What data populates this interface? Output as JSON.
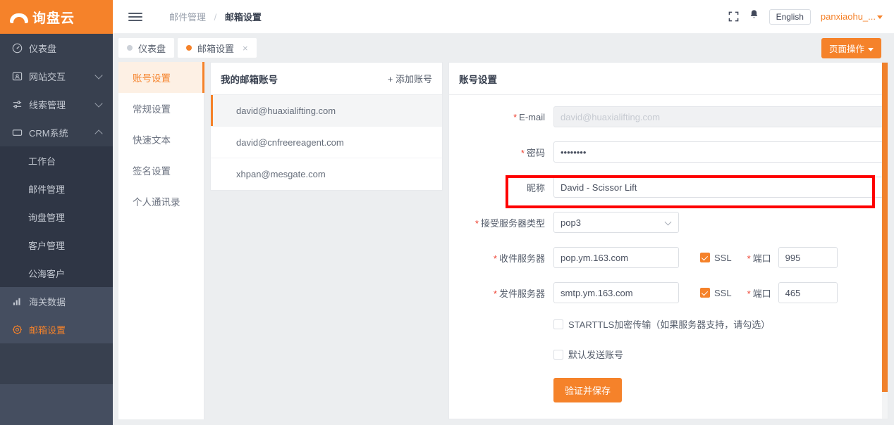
{
  "brand": {
    "name": "询盘云",
    "logo_icon": "cloud-logo-icon",
    "color": "#f5822a"
  },
  "sidebar": {
    "items": [
      {
        "label": "仪表盘",
        "icon": "dashboard-icon",
        "level": "top",
        "state": "normal",
        "chevron": ""
      },
      {
        "label": "网站交互",
        "icon": "monitor-person-icon",
        "level": "top",
        "state": "normal",
        "chevron": "down"
      },
      {
        "label": "线索管理",
        "icon": "sliders-icon",
        "level": "top",
        "state": "normal",
        "chevron": "down"
      },
      {
        "label": "CRM系统",
        "icon": "display-icon",
        "level": "top",
        "state": "normal",
        "chevron": "up"
      },
      {
        "label": "工作台",
        "icon": "",
        "level": "sub",
        "state": "normal",
        "chevron": ""
      },
      {
        "label": "邮件管理",
        "icon": "",
        "level": "sub",
        "state": "normal",
        "chevron": ""
      },
      {
        "label": "询盘管理",
        "icon": "",
        "level": "sub",
        "state": "normal",
        "chevron": ""
      },
      {
        "label": "客户管理",
        "icon": "",
        "level": "sub",
        "state": "normal",
        "chevron": ""
      },
      {
        "label": "公海客户",
        "icon": "",
        "level": "sub",
        "state": "normal",
        "chevron": ""
      },
      {
        "label": "海关数据",
        "icon": "bar-chart-icon",
        "level": "top",
        "state": "hovered",
        "chevron": ""
      },
      {
        "label": "邮箱设置",
        "icon": "gear-icon",
        "level": "top",
        "state": "active",
        "chevron": ""
      }
    ]
  },
  "topbar": {
    "menu_icon": "hamburger-icon",
    "breadcrumb": {
      "parent": "邮件管理",
      "separator": "/",
      "current": "邮箱设置"
    },
    "fullscreen_icon": "expand-icon",
    "bell_icon": "bell-icon",
    "language": "English",
    "user": "panxiaohu_...",
    "user_caret": "caret-down-icon"
  },
  "tabs": {
    "items": [
      {
        "label": "仪表盘",
        "active": false,
        "closable": false
      },
      {
        "label": "邮箱设置",
        "active": true,
        "closable": true
      }
    ],
    "close_glyph": "×",
    "page_action": "页面操作"
  },
  "settings_menu": {
    "items": [
      {
        "label": "账号设置",
        "active": true
      },
      {
        "label": "常规设置",
        "active": false
      },
      {
        "label": "快速文本",
        "active": false
      },
      {
        "label": "签名设置",
        "active": false
      },
      {
        "label": "个人通讯录",
        "active": false
      }
    ]
  },
  "accounts": {
    "title": "我的邮箱账号",
    "add_label": "+ 添加账号",
    "items": [
      {
        "email": "david@huaxialifting.com",
        "active": true
      },
      {
        "email": "david@cnfreereagent.com",
        "active": false
      },
      {
        "email": "xhpan@mesgate.com",
        "active": false
      }
    ]
  },
  "form": {
    "title": "账号设置",
    "email": {
      "label": "E-mail",
      "required": true,
      "value": "",
      "placeholder": "david@huaxialifting.com",
      "disabled": true
    },
    "password": {
      "label": "密码",
      "required": true,
      "value": "••••••••"
    },
    "nickname": {
      "label": "昵称",
      "required": false,
      "value": "David - Scissor Lift",
      "highlighted": true
    },
    "server_type": {
      "label": "接受服务器类型",
      "required": true,
      "value": "pop3",
      "chevron_icon": "chevron-down-icon"
    },
    "incoming": {
      "label": "收件服务器",
      "required": true,
      "value": "pop.ym.163.com",
      "ssl_label": "SSL",
      "ssl_checked": true,
      "port_label": "端口",
      "port_required": true,
      "port": "995"
    },
    "outgoing": {
      "label": "发件服务器",
      "required": true,
      "value": "smtp.ym.163.com",
      "ssl_label": "SSL",
      "ssl_checked": true,
      "port_label": "端口",
      "port_required": true,
      "port": "465"
    },
    "starttls": {
      "label": "STARTTLS加密传输（如果服务器支持，请勾选）",
      "checked": false
    },
    "default_send": {
      "label": "默认发送账号",
      "checked": false
    },
    "save_button": "验证并保存"
  },
  "annotation": {
    "type": "red-rectangle",
    "color": "#fe0000",
    "target": "nickname-field-row"
  }
}
